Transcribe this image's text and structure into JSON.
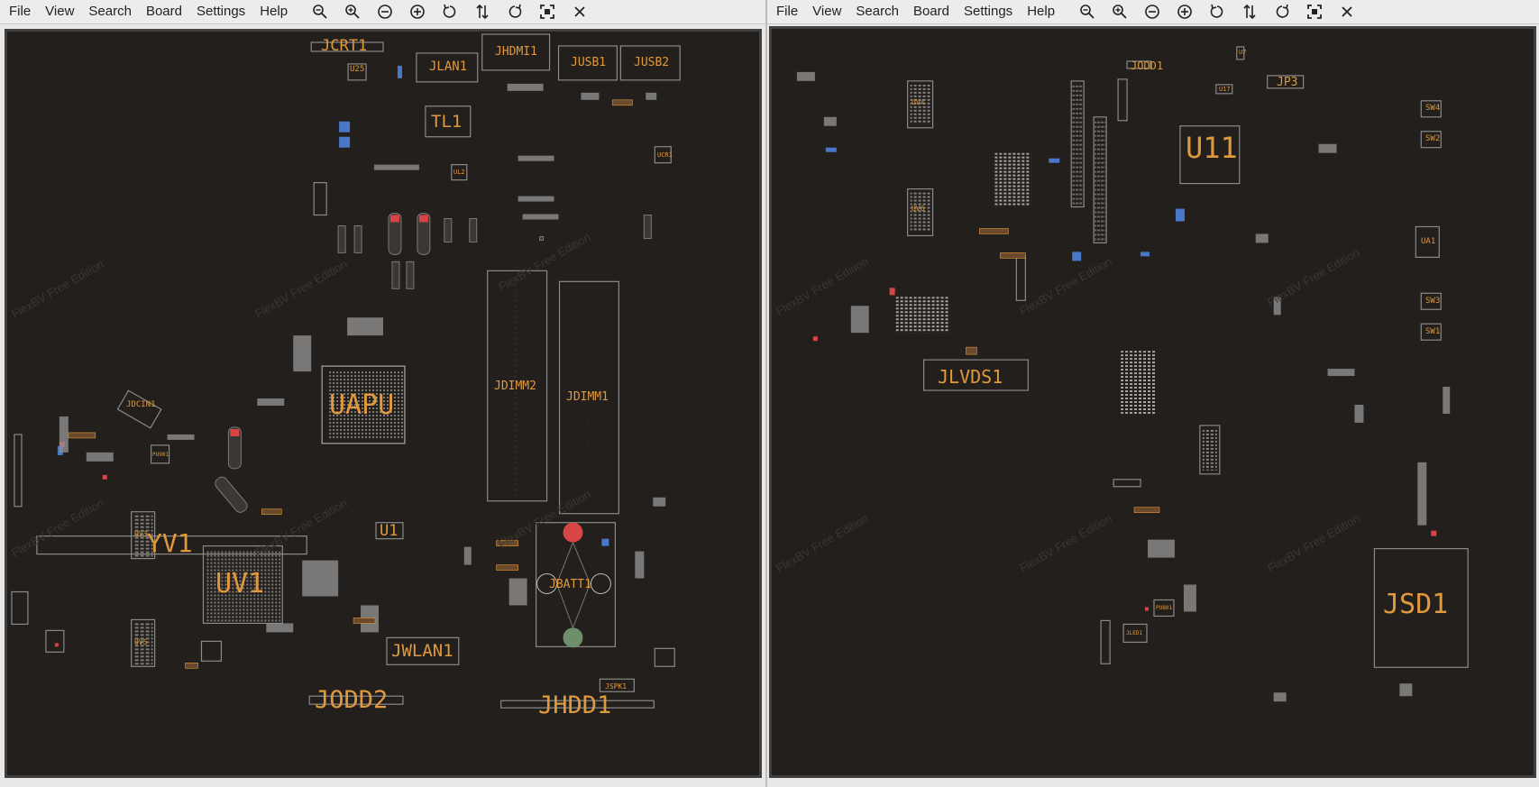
{
  "menus": [
    "File",
    "View",
    "Search",
    "Board",
    "Settings",
    "Help"
  ],
  "toolbar": [
    "zoom-out-icon",
    "zoom-in-icon",
    "zoom-minus-circle-icon",
    "zoom-plus-circle-icon",
    "rotate-left-icon",
    "flip-icon",
    "rotate-right-icon",
    "fit-screen-icon",
    "close-icon"
  ],
  "watermark": "FlexBV Free Edition",
  "left_labels": {
    "jcrt1": "JCRT1",
    "u25": "U25",
    "jlan1": "JLAN1",
    "jhdmi1": "JHDMI1",
    "jusb1": "JUSB1",
    "jusb2": "JUSB2",
    "tl1": "TL1",
    "ul2": "UL2",
    "ucr1": "UCR1",
    "uapu": "UAPU",
    "jdimm2": "JDIMM2",
    "jdimm1": "JDIMM1",
    "jdcin1": "JDCIN1",
    "pu901": "PU901",
    "yv1": "YV1",
    "uv1": "UV1",
    "u1": "U1",
    "jbatt1": "JBATT1",
    "jwlan1": "JWLAN1",
    "jodd2": "JODD2",
    "jhdd1": "JHDD1",
    "jspk1": "JSPK1",
    "uv3": "UV3",
    "uv5": "UV5"
  },
  "right_labels": {
    "jodd1": "JODD1",
    "u7": "U7",
    "u17": "U17",
    "jp3": "JP3",
    "uv4": "UV4",
    "uv6": "UV6",
    "u11": "U11",
    "sw4": "SW4",
    "sw2": "SW2",
    "ua1": "UA1",
    "sw3": "SW3",
    "sw1": "SW1",
    "jlvds1": "JLVDS1",
    "jsd1": "JSD1",
    "pu801": "PU801",
    "jled1": "JLED1"
  },
  "colors": {
    "board": "#231f1c",
    "label": "#e0993c",
    "outline": "#8a8a8a",
    "pad": "#bfbfbf",
    "pin_red": "#d94545",
    "pin_blue": "#4a78c8",
    "pin_green": "#6e8f6a"
  }
}
